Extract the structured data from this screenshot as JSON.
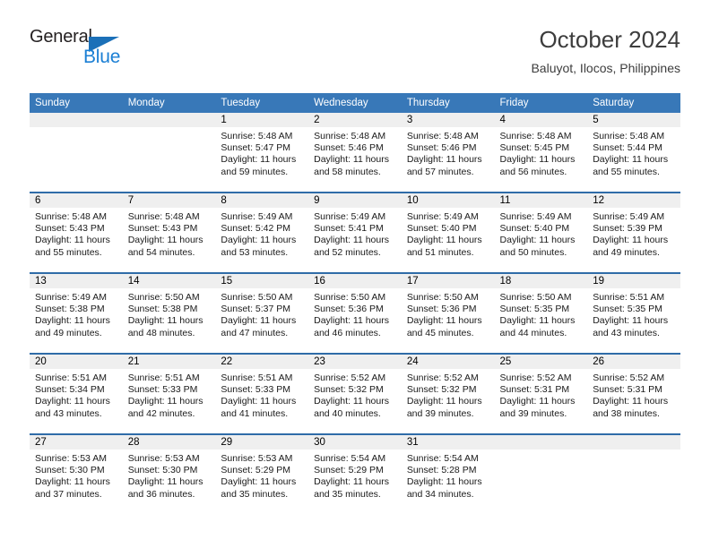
{
  "brand": {
    "name_part1": "General",
    "name_part2": "Blue",
    "accent_color": "#1b7fd4",
    "triangle_color": "#1b70b8"
  },
  "header": {
    "title": "October 2024",
    "subtitle": "Baluyot, Ilocos, Philippines"
  },
  "theme": {
    "header_bg": "#3878b8",
    "row_divider": "#2f6ca8",
    "daynum_bg": "#efefef"
  },
  "weekday_headers": [
    "Sunday",
    "Monday",
    "Tuesday",
    "Wednesday",
    "Thursday",
    "Friday",
    "Saturday"
  ],
  "weeks": [
    [
      {
        "day": "",
        "sunrise": "",
        "sunset": "",
        "daylight1": "",
        "daylight2": ""
      },
      {
        "day": "",
        "sunrise": "",
        "sunset": "",
        "daylight1": "",
        "daylight2": ""
      },
      {
        "day": "1",
        "sunrise": "Sunrise: 5:48 AM",
        "sunset": "Sunset: 5:47 PM",
        "daylight1": "Daylight: 11 hours",
        "daylight2": "and 59 minutes."
      },
      {
        "day": "2",
        "sunrise": "Sunrise: 5:48 AM",
        "sunset": "Sunset: 5:46 PM",
        "daylight1": "Daylight: 11 hours",
        "daylight2": "and 58 minutes."
      },
      {
        "day": "3",
        "sunrise": "Sunrise: 5:48 AM",
        "sunset": "Sunset: 5:46 PM",
        "daylight1": "Daylight: 11 hours",
        "daylight2": "and 57 minutes."
      },
      {
        "day": "4",
        "sunrise": "Sunrise: 5:48 AM",
        "sunset": "Sunset: 5:45 PM",
        "daylight1": "Daylight: 11 hours",
        "daylight2": "and 56 minutes."
      },
      {
        "day": "5",
        "sunrise": "Sunrise: 5:48 AM",
        "sunset": "Sunset: 5:44 PM",
        "daylight1": "Daylight: 11 hours",
        "daylight2": "and 55 minutes."
      }
    ],
    [
      {
        "day": "6",
        "sunrise": "Sunrise: 5:48 AM",
        "sunset": "Sunset: 5:43 PM",
        "daylight1": "Daylight: 11 hours",
        "daylight2": "and 55 minutes."
      },
      {
        "day": "7",
        "sunrise": "Sunrise: 5:48 AM",
        "sunset": "Sunset: 5:43 PM",
        "daylight1": "Daylight: 11 hours",
        "daylight2": "and 54 minutes."
      },
      {
        "day": "8",
        "sunrise": "Sunrise: 5:49 AM",
        "sunset": "Sunset: 5:42 PM",
        "daylight1": "Daylight: 11 hours",
        "daylight2": "and 53 minutes."
      },
      {
        "day": "9",
        "sunrise": "Sunrise: 5:49 AM",
        "sunset": "Sunset: 5:41 PM",
        "daylight1": "Daylight: 11 hours",
        "daylight2": "and 52 minutes."
      },
      {
        "day": "10",
        "sunrise": "Sunrise: 5:49 AM",
        "sunset": "Sunset: 5:40 PM",
        "daylight1": "Daylight: 11 hours",
        "daylight2": "and 51 minutes."
      },
      {
        "day": "11",
        "sunrise": "Sunrise: 5:49 AM",
        "sunset": "Sunset: 5:40 PM",
        "daylight1": "Daylight: 11 hours",
        "daylight2": "and 50 minutes."
      },
      {
        "day": "12",
        "sunrise": "Sunrise: 5:49 AM",
        "sunset": "Sunset: 5:39 PM",
        "daylight1": "Daylight: 11 hours",
        "daylight2": "and 49 minutes."
      }
    ],
    [
      {
        "day": "13",
        "sunrise": "Sunrise: 5:49 AM",
        "sunset": "Sunset: 5:38 PM",
        "daylight1": "Daylight: 11 hours",
        "daylight2": "and 49 minutes."
      },
      {
        "day": "14",
        "sunrise": "Sunrise: 5:50 AM",
        "sunset": "Sunset: 5:38 PM",
        "daylight1": "Daylight: 11 hours",
        "daylight2": "and 48 minutes."
      },
      {
        "day": "15",
        "sunrise": "Sunrise: 5:50 AM",
        "sunset": "Sunset: 5:37 PM",
        "daylight1": "Daylight: 11 hours",
        "daylight2": "and 47 minutes."
      },
      {
        "day": "16",
        "sunrise": "Sunrise: 5:50 AM",
        "sunset": "Sunset: 5:36 PM",
        "daylight1": "Daylight: 11 hours",
        "daylight2": "and 46 minutes."
      },
      {
        "day": "17",
        "sunrise": "Sunrise: 5:50 AM",
        "sunset": "Sunset: 5:36 PM",
        "daylight1": "Daylight: 11 hours",
        "daylight2": "and 45 minutes."
      },
      {
        "day": "18",
        "sunrise": "Sunrise: 5:50 AM",
        "sunset": "Sunset: 5:35 PM",
        "daylight1": "Daylight: 11 hours",
        "daylight2": "and 44 minutes."
      },
      {
        "day": "19",
        "sunrise": "Sunrise: 5:51 AM",
        "sunset": "Sunset: 5:35 PM",
        "daylight1": "Daylight: 11 hours",
        "daylight2": "and 43 minutes."
      }
    ],
    [
      {
        "day": "20",
        "sunrise": "Sunrise: 5:51 AM",
        "sunset": "Sunset: 5:34 PM",
        "daylight1": "Daylight: 11 hours",
        "daylight2": "and 43 minutes."
      },
      {
        "day": "21",
        "sunrise": "Sunrise: 5:51 AM",
        "sunset": "Sunset: 5:33 PM",
        "daylight1": "Daylight: 11 hours",
        "daylight2": "and 42 minutes."
      },
      {
        "day": "22",
        "sunrise": "Sunrise: 5:51 AM",
        "sunset": "Sunset: 5:33 PM",
        "daylight1": "Daylight: 11 hours",
        "daylight2": "and 41 minutes."
      },
      {
        "day": "23",
        "sunrise": "Sunrise: 5:52 AM",
        "sunset": "Sunset: 5:32 PM",
        "daylight1": "Daylight: 11 hours",
        "daylight2": "and 40 minutes."
      },
      {
        "day": "24",
        "sunrise": "Sunrise: 5:52 AM",
        "sunset": "Sunset: 5:32 PM",
        "daylight1": "Daylight: 11 hours",
        "daylight2": "and 39 minutes."
      },
      {
        "day": "25",
        "sunrise": "Sunrise: 5:52 AM",
        "sunset": "Sunset: 5:31 PM",
        "daylight1": "Daylight: 11 hours",
        "daylight2": "and 39 minutes."
      },
      {
        "day": "26",
        "sunrise": "Sunrise: 5:52 AM",
        "sunset": "Sunset: 5:31 PM",
        "daylight1": "Daylight: 11 hours",
        "daylight2": "and 38 minutes."
      }
    ],
    [
      {
        "day": "27",
        "sunrise": "Sunrise: 5:53 AM",
        "sunset": "Sunset: 5:30 PM",
        "daylight1": "Daylight: 11 hours",
        "daylight2": "and 37 minutes."
      },
      {
        "day": "28",
        "sunrise": "Sunrise: 5:53 AM",
        "sunset": "Sunset: 5:30 PM",
        "daylight1": "Daylight: 11 hours",
        "daylight2": "and 36 minutes."
      },
      {
        "day": "29",
        "sunrise": "Sunrise: 5:53 AM",
        "sunset": "Sunset: 5:29 PM",
        "daylight1": "Daylight: 11 hours",
        "daylight2": "and 35 minutes."
      },
      {
        "day": "30",
        "sunrise": "Sunrise: 5:54 AM",
        "sunset": "Sunset: 5:29 PM",
        "daylight1": "Daylight: 11 hours",
        "daylight2": "and 35 minutes."
      },
      {
        "day": "31",
        "sunrise": "Sunrise: 5:54 AM",
        "sunset": "Sunset: 5:28 PM",
        "daylight1": "Daylight: 11 hours",
        "daylight2": "and 34 minutes."
      },
      {
        "day": "",
        "sunrise": "",
        "sunset": "",
        "daylight1": "",
        "daylight2": ""
      },
      {
        "day": "",
        "sunrise": "",
        "sunset": "",
        "daylight1": "",
        "daylight2": ""
      }
    ]
  ]
}
